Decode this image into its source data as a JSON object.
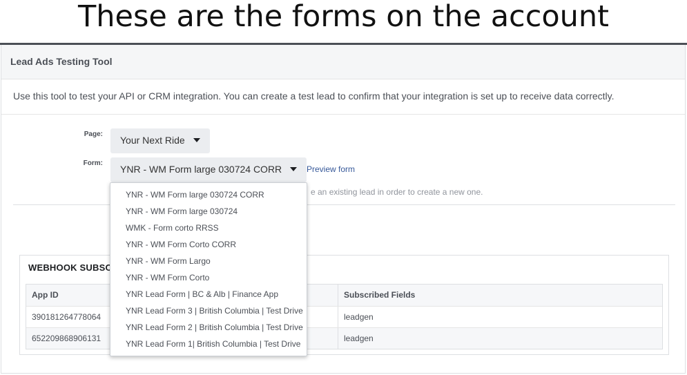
{
  "caption": "These are the forms on the account",
  "panel": {
    "title": "Lead Ads Testing Tool",
    "description": "Use this tool to test your API or CRM integration. You can create a test lead to confirm that your integration is set up to receive data correctly."
  },
  "page_field": {
    "label": "Page:",
    "value": "Your Next Ride"
  },
  "form_field": {
    "label": "Form:",
    "value": "YNR - WM Form large 030724 CORR"
  },
  "preview_link": "Preview form",
  "hint": "e an existing lead in order to create a new one.",
  "dropdown": {
    "options": [
      "YNR - WM Form large 030724 CORR",
      "YNR - WM Form large 030724",
      "WMK - Form corto RRSS",
      "YNR - WM Form Corto CORR",
      "YNR - WM Form Largo",
      "YNR - WM Form Corto",
      "YNR Lead Form | BC & Alb | Finance App",
      "YNR Lead Form 3 | British Columbia | Test Drive",
      "YNR Lead Form 2 | British Columbia | Test Drive",
      "YNR Lead Form 1| British Columbia | Test Drive"
    ]
  },
  "webhook": {
    "title": "WEBHOOK SUBSC",
    "columns": [
      "App ID",
      "Subscribed Fields"
    ],
    "rows": [
      [
        "390181264778064",
        "leadgen"
      ],
      [
        "652209868906131",
        "leadgen"
      ]
    ]
  },
  "colors": {
    "link": "#365899",
    "select_bg": "#ebedf0",
    "header_bg": "#f5f6f7"
  }
}
